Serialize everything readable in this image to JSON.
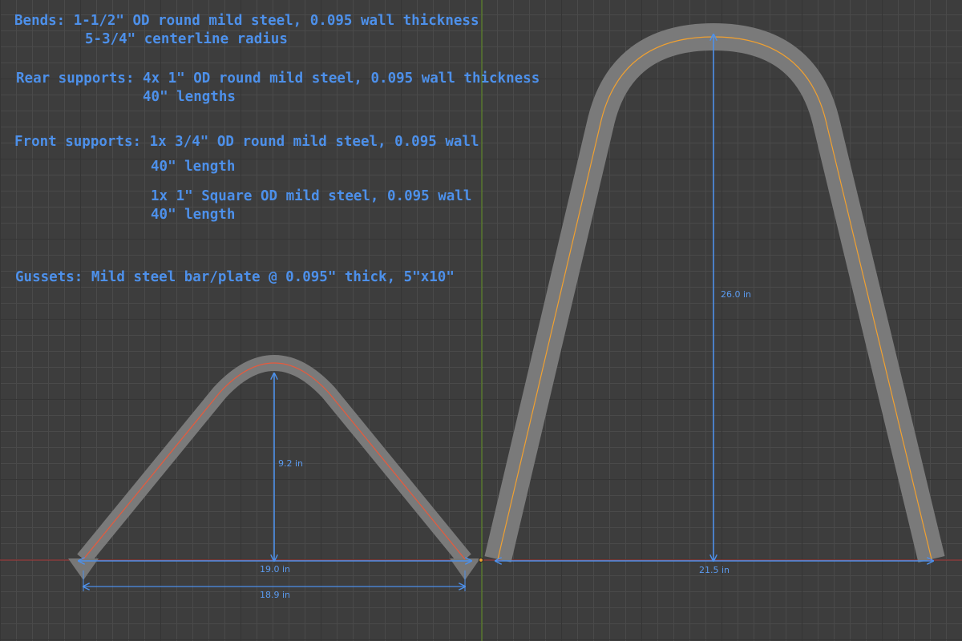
{
  "notes": {
    "bends_line1": "Bends: 1-1/2\" OD round mild steel, 0.095 wall thickness",
    "bends_line2": "5-3/4\" centerline radius",
    "rear_line1": "Rear supports: 4x 1\" OD round mild steel, 0.095 wall thickness",
    "rear_line2": "40\" lengths",
    "front_line1": "Front supports: 1x 3/4\" OD round mild steel, 0.095 wall",
    "front_line2": "40\" length",
    "front_line3": "1x 1\" Square OD mild steel, 0.095 wall",
    "front_line4": "40\" length",
    "gussets": "Gussets: Mild steel bar/plate @ 0.095\" thick, 5\"x10\""
  },
  "dimensions": {
    "small_height": "9.2 in",
    "small_base_width": "19.0 in",
    "small_inner_width": "18.9 in",
    "large_height": "26.0 in",
    "large_base_width": "21.5 in"
  },
  "colors": {
    "background": "#3d3d3d",
    "tube": "#7a7a7a",
    "small_centerline": "#e85a3c",
    "large_centerline": "#f0a030",
    "dimension": "#4d90ea",
    "x_axis": "#b03a3a",
    "y_axis": "#6a9a2a"
  }
}
